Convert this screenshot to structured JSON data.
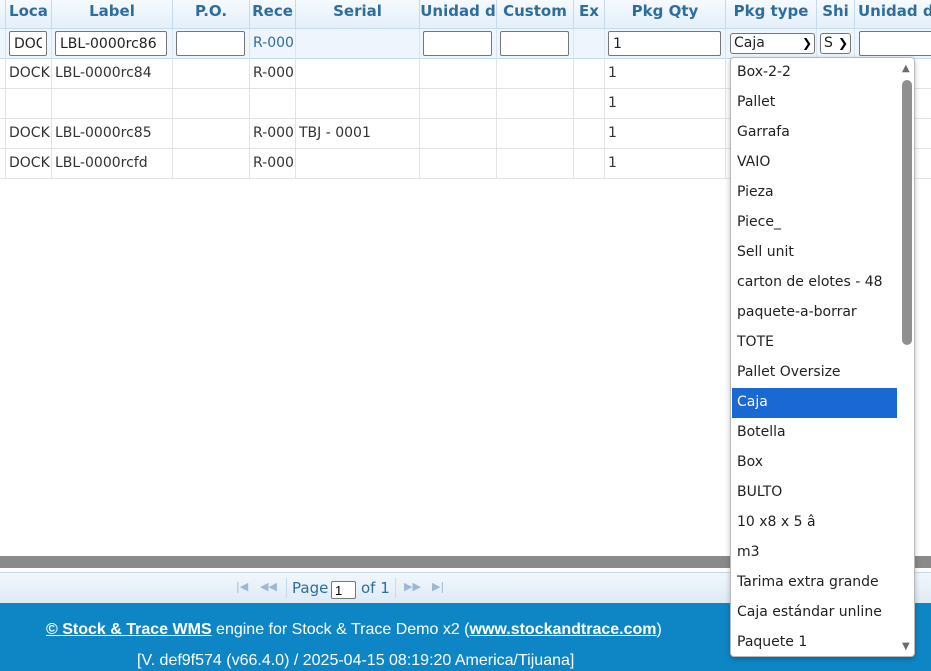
{
  "columns": [
    "Loca",
    "Label",
    "P.O.",
    "Rece",
    "Serial",
    "Unidad d",
    "Custom",
    "Ex",
    "Pkg Qty",
    "Pkg type",
    "Shi",
    "Unidad de"
  ],
  "filter": {
    "location": "DOC",
    "label": "LBL-0000rc86",
    "po": "",
    "receipt": "R-000",
    "unidad": "",
    "custom": "",
    "pkg_qty": "1",
    "pkg_type": "Caja",
    "ship": "S",
    "unidad_de": ""
  },
  "rows": [
    {
      "location": "DOCK",
      "label": "LBL-0000rc84",
      "receipt": "R-000",
      "serial": "",
      "pkg_qty": "1"
    },
    {
      "location": "",
      "label": "",
      "receipt": "",
      "serial": "",
      "pkg_qty": "1"
    },
    {
      "location": "DOCK",
      "label": "LBL-0000rc85",
      "receipt": "R-000",
      "serial": "TBJ - 0001",
      "pkg_qty": "1"
    },
    {
      "location": "DOCK",
      "label": "LBL-0000rcfd",
      "receipt": "R-000",
      "serial": "",
      "pkg_qty": "1"
    }
  ],
  "dropdown": {
    "options": [
      "Box-2-2",
      "Pallet",
      "Garrafa",
      "VAIO",
      "Pieza",
      "Piece_",
      "Sell unit",
      "carton de elotes - 48",
      "paquete-a-borrar",
      "TOTE",
      "Pallet Oversize",
      "Caja",
      "Botella",
      "Box",
      "BULTO",
      "10 x8 x 5 â",
      "m3",
      "Tarima extra grande",
      "Caja estándar unline",
      "Paquete 1"
    ],
    "selected_index": 11
  },
  "pager": {
    "page_label": "Page",
    "page_value": "1",
    "of_label": "of 1"
  },
  "footer": {
    "brand": "© Stock & Trace WMS",
    "engine_text": " engine for Stock & Trace Demo x2 (",
    "site": "www.stockandtrace.com",
    "close_paren": ")",
    "version": "[V. def9f574 (v66.4.0) / 2025-04-15 08:19:20 America/Tijuana]"
  },
  "colors": {
    "header_text": "#2e6e9e",
    "footer_bg": "#0e86c5",
    "selected_option": "#1a68d3"
  }
}
